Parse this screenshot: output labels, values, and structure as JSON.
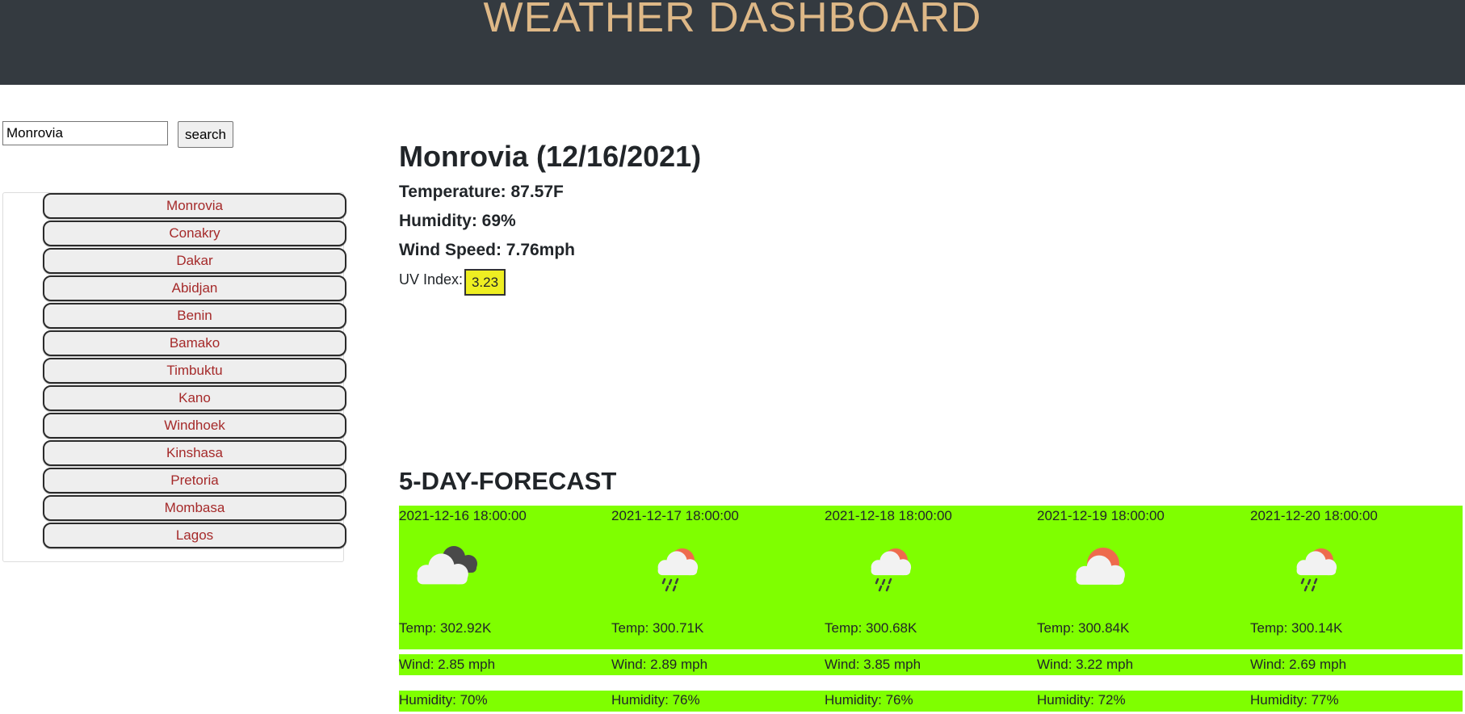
{
  "header": {
    "title": "WEATHER DASHBOARD"
  },
  "search": {
    "value": "Monrovia",
    "button_label": "search"
  },
  "history": [
    "Monrovia",
    "Conakry",
    "Dakar",
    "Abidjan",
    "Benin",
    "Bamako",
    "Timbuktu",
    "Kano",
    "Windhoek",
    "Kinshasa",
    "Pretoria",
    "Mombasa",
    "Lagos"
  ],
  "current": {
    "title": "Monrovia (12/16/2021)",
    "temperature": "Temperature: 87.57F",
    "humidity": "Humidity: 69%",
    "wind": "Wind Speed: 7.76mph",
    "uv_label": "UV Index:",
    "uv_value": "3.23",
    "uv_color": "#eeee22"
  },
  "forecast": {
    "title": "5-DAY-FORECAST",
    "band_color": "#7fff00",
    "days": [
      {
        "date": "2021-12-16 18:00:00",
        "icon": "broken-clouds-icon",
        "temp": "Temp: 302.92K",
        "wind": "Wind: 2.85 mph",
        "humidity": "Humidity: 70%"
      },
      {
        "date": "2021-12-17 18:00:00",
        "icon": "light-rain-icon",
        "temp": "Temp: 300.71K",
        "wind": "Wind: 2.89 mph",
        "humidity": "Humidity: 76%"
      },
      {
        "date": "2021-12-18 18:00:00",
        "icon": "light-rain-icon",
        "temp": "Temp: 300.68K",
        "wind": "Wind: 3.85 mph",
        "humidity": "Humidity: 76%"
      },
      {
        "date": "2021-12-19 18:00:00",
        "icon": "partly-cloudy-icon",
        "temp": "Temp: 300.84K",
        "wind": "Wind: 3.22 mph",
        "humidity": "Humidity: 72%"
      },
      {
        "date": "2021-12-20 18:00:00",
        "icon": "light-rain-icon",
        "temp": "Temp: 300.14K",
        "wind": "Wind: 2.69 mph",
        "humidity": "Humidity: 77%"
      }
    ]
  }
}
